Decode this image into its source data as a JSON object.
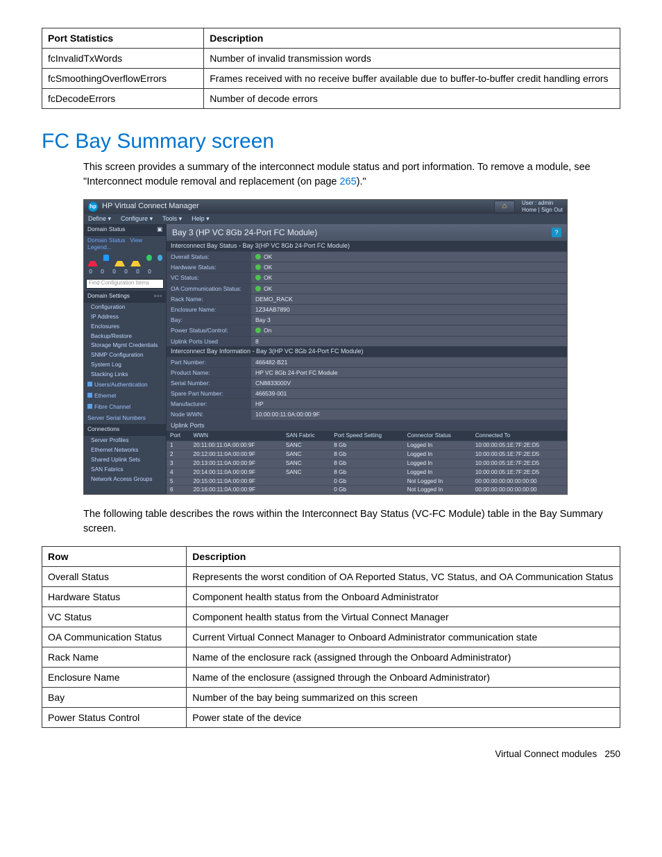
{
  "port_stats_table": {
    "headers": [
      "Port Statistics",
      "Description"
    ],
    "rows": [
      [
        "fcInvalidTxWords",
        "Number of invalid transmission words"
      ],
      [
        "fcSmoothingOverflowErrors",
        "Frames received with no receive buffer available due to buffer-to-buffer credit handling errors"
      ],
      [
        "fcDecodeErrors",
        "Number of decode errors"
      ]
    ]
  },
  "section_heading": "FC Bay Summary screen",
  "intro_text_1": "This screen provides a summary of the interconnect module status and port information. To remove a module, see \"Interconnect module removal and replacement (on page ",
  "intro_link": "265",
  "intro_text_2": ").\"",
  "screenshot": {
    "app_title": "HP Virtual Connect Manager",
    "user_label": "User : admin",
    "home_signout": "Home  |  Sign Out",
    "menus": [
      "Define ▾",
      "Configure ▾",
      "Tools ▾",
      "Help ▾"
    ],
    "sidebar": {
      "domain_status_hdr": "Domain Status",
      "domain_status_link": "Domain Status",
      "view_legend": "View Legend...",
      "counts": [
        "0",
        "0",
        "0",
        "0",
        "0",
        "0"
      ],
      "search_placeholder": "Find Configuration Items",
      "domain_settings_hdr": "Domain Settings",
      "items1": [
        "Configuration",
        "IP Address",
        "Enclosures",
        "Backup/Restore",
        "Storage Mgmt Credentials",
        "SNMP Configuration",
        "System Log",
        "Stacking Links"
      ],
      "items2": [
        {
          "icon": true,
          "label": "Users/Authentication"
        },
        {
          "icon": true,
          "label": "Ethernet"
        },
        {
          "icon": true,
          "label": "Fibre Channel"
        },
        {
          "icon": false,
          "label": "Server Serial Numbers"
        }
      ],
      "connections_hdr": "Connections",
      "items3": [
        "Server Profiles",
        "Ethernet Networks",
        "Shared Uplink Sets",
        "SAN Fabrics",
        "Network Access Groups"
      ]
    },
    "main": {
      "page_title": "Bay 3 (HP VC 8Gb 24-Port FC Module)",
      "status_panel_hdr": "Interconnect Bay Status - Bay 3(HP VC 8Gb 24-Port FC Module)",
      "status_rows": [
        {
          "k": "Overall Status:",
          "v": "OK",
          "ok": true
        },
        {
          "k": "Hardware Status:",
          "v": "OK",
          "ok": true
        },
        {
          "k": "VC Status:",
          "v": "OK",
          "ok": true
        },
        {
          "k": "OA Communication Status:",
          "v": "OK",
          "ok": true
        },
        {
          "k": "Rack Name:",
          "v": "DEMO_RACK",
          "ok": false
        },
        {
          "k": "Enclosure Name:",
          "v": "1Z34AB7890",
          "ok": false
        },
        {
          "k": "Bay:",
          "v": "Bay 3",
          "ok": false
        },
        {
          "k": "Power Status/Control:",
          "v": "On",
          "ok": true
        },
        {
          "k": "Uplink Ports Used",
          "v": "8",
          "ok": false
        }
      ],
      "info_panel_hdr": "Interconnect Bay Information - Bay 3(HP VC 8Gb 24-Port FC Module)",
      "info_rows": [
        {
          "k": "Part Number:",
          "v": "466482-B21"
        },
        {
          "k": "Product Name:",
          "v": "HP VC 8Gb 24-Port FC Module"
        },
        {
          "k": "Serial Number:",
          "v": "CN8833000V"
        },
        {
          "k": "Spare Part Number:",
          "v": "466539-001"
        },
        {
          "k": "Manufacturer:",
          "v": "HP"
        },
        {
          "k": "Node WWN:",
          "v": "10:00:00:11:0A:00:00:9F"
        }
      ],
      "uplink_hdr": "Uplink Ports",
      "uplink_cols": [
        "Port",
        "WWN",
        "SAN Fabric",
        "Port Speed Setting",
        "Connector Status",
        "Connected To"
      ],
      "uplink_rows": [
        [
          "1",
          "20:11:00:11:0A:00:00:9F",
          "SANC",
          "8 Gb",
          "Logged In",
          "10:00:00:05:1E:7F:2E:D5"
        ],
        [
          "2",
          "20:12:00:11:0A:00:00:9F",
          "SANC",
          "8 Gb",
          "Logged In",
          "10:00:00:05:1E:7F:2E:D5"
        ],
        [
          "3",
          "20:13:00:11:0A:00:00:9F",
          "SANC",
          "8 Gb",
          "Logged In",
          "10:00:00:05:1E:7F:2E:D5"
        ],
        [
          "4",
          "20:14:00:11:0A:00:00:9F",
          "SANC",
          "8 Gb",
          "Logged In",
          "10:00:00:05:1E:7F:2E:D5"
        ],
        [
          "5",
          "20:15:00:11:0A:00:00:9F",
          "",
          "0 Gb",
          "Not Logged In",
          "00:00:00:00:00:00:00:00"
        ],
        [
          "6",
          "20:16:00:11:0A:00:00:9F",
          "",
          "0 Gb",
          "Not Logged In",
          "00:00:00:00:00:00:00:00"
        ]
      ]
    }
  },
  "table_intro": "The following table describes the rows within the Interconnect Bay Status (VC-FC Module) table in the Bay Summary screen.",
  "row_table": {
    "headers": [
      "Row",
      "Description"
    ],
    "rows": [
      [
        "Overall Status",
        "Represents the worst condition of OA Reported Status, VC Status, and OA Communication Status"
      ],
      [
        "Hardware Status",
        "Component health status from the Onboard Administrator"
      ],
      [
        "VC Status",
        "Component health status from the Virtual Connect Manager"
      ],
      [
        "OA Communication Status",
        "Current Virtual Connect Manager to Onboard Administrator communication state"
      ],
      [
        "Rack Name",
        "Name of the enclosure rack (assigned through the Onboard Administrator)"
      ],
      [
        "Enclosure Name",
        "Name of the enclosure (assigned through the Onboard Administrator)"
      ],
      [
        "Bay",
        "Number of the bay being summarized on this screen"
      ],
      [
        "Power Status Control",
        "Power state of the device"
      ]
    ]
  },
  "footer": {
    "section": "Virtual Connect modules",
    "page": "250"
  }
}
